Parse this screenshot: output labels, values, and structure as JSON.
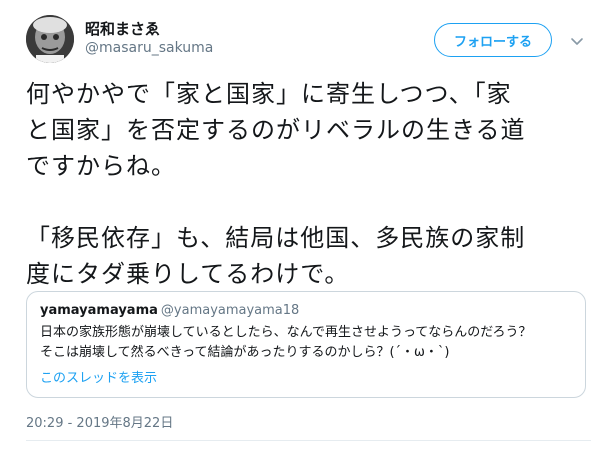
{
  "user": {
    "display_name": "昭和まさゑ",
    "screen_name": "@masaru_sakuma",
    "avatar_icon": "avatar-portrait"
  },
  "follow_label": "フォローする",
  "caret_icon": "chevron-down-icon",
  "tweet": {
    "lines": [
      "何やかやで「家と国家」に寄生しつつ、「家",
      "と国家」を否定するのがリベラルの生きる道",
      "ですからね。",
      "「移民依存」も、結局は他国、多民族の家制",
      "度にタダ乗りしてるわけで。"
    ]
  },
  "quote": {
    "name": "yamayamayama",
    "handle": "@yamayamayama18",
    "lines": [
      "日本の家族形態が崩壊しているとしたら、なんで再生させようってならんのだろう？",
      "そこは崩壊して然るべきって結論があったりするのかしら？(´・ω・`)"
    ],
    "thread_link": "このスレッドを表示"
  },
  "timestamp": "20:29 - 2019年8月22日",
  "colors": {
    "accent": "#1da1f2",
    "text": "#14171a",
    "muted": "#657786",
    "border": "#ccd6dd"
  }
}
